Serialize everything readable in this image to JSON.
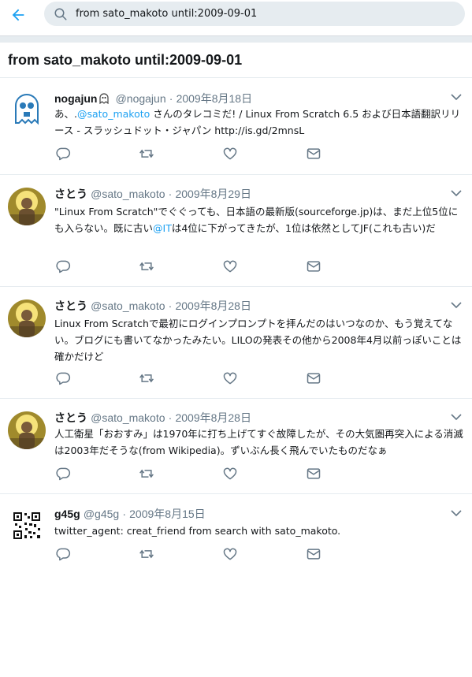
{
  "header": {
    "back_icon": "arrow-left-icon",
    "search_icon": "search-icon",
    "search_value": "from sato_makoto until:2009-09-01"
  },
  "page": {
    "title": "from sato_makoto until:2009-09-01"
  },
  "colors": {
    "accent": "#1da1f2",
    "text": "#14171a",
    "muted": "#657786",
    "divider": "#e6ecf0"
  },
  "tweets": [
    {
      "name": "nogajun",
      "name_badge_icon": "ghost-emoji-icon",
      "handle": "@nogajun",
      "dot": "·",
      "date": "2009年8月18日",
      "text_before": "あ、.",
      "link": "@sato_makoto",
      "text_after": " さんのタレコミだ! / Linux From Scratch 6.5 および日本語翻訳リリース - スラッシュドット・ジャパン http://is.gd/2mnsL"
    },
    {
      "name": "さとう",
      "handle": "@sato_makoto",
      "dot": "·",
      "date": "2009年8月29日",
      "text_before": "\"Linux From Scratch\"でぐぐっても、日本語の最新版(sourceforge.jp)は、まだ上位5位にも入らない。既に古い",
      "link": "@IT",
      "text_after": "は4位に下がってきたが、1位は依然としてJF(これも古い)だ"
    },
    {
      "name": "さとう",
      "handle": "@sato_makoto",
      "dot": "·",
      "date": "2009年8月28日",
      "text": "Linux From Scratchで最初にログインプロンプトを拝んだのはいつなのか、もう覚えてない。ブログにも書いてなかったみたい。LILOの発表その他から2008年4月以前っぽいことは確かだけど"
    },
    {
      "name": "さとう",
      "handle": "@sato_makoto",
      "dot": "·",
      "date": "2009年8月28日",
      "text": "人工衛星「おおすみ」は1970年に打ち上げてすぐ故障したが、その大気圏再突入による消滅は2003年だそうな(from Wikipedia)。ずいぶん長く飛んでいたものだなぁ"
    },
    {
      "name": "g45g",
      "handle": "@g45g",
      "dot": "·",
      "date": "2009年8月15日",
      "text": "twitter_agent: creat_friend from search with sato_makoto."
    }
  ],
  "tweet_action_icons": [
    "reply-icon",
    "retweet-icon",
    "like-icon",
    "direct-message-icon"
  ],
  "tweet_menu_icon": "chevron-down-icon"
}
